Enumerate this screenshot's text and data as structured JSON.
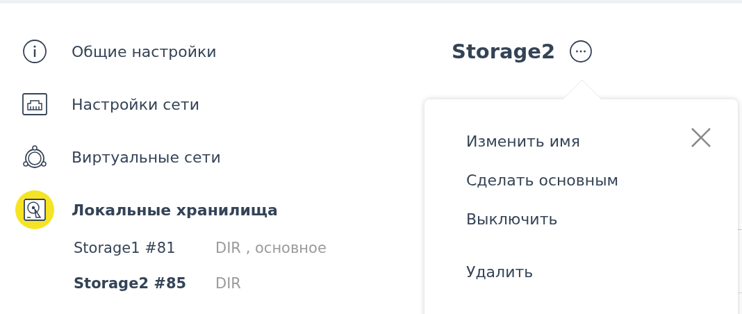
{
  "sidebar": {
    "items": [
      {
        "label": "Общие настройки",
        "kind": "info",
        "selected": false
      },
      {
        "label": "Настройки сети",
        "kind": "network",
        "selected": false
      },
      {
        "label": "Виртуальные сети",
        "kind": "virtual",
        "selected": false
      },
      {
        "label": "Локальные хранилища",
        "kind": "storage",
        "selected": true
      }
    ],
    "storages": [
      {
        "name": "Storage1 #81",
        "type": "DIR , основное",
        "selected": false
      },
      {
        "name": "Storage2 #85",
        "type": "DIR",
        "selected": true
      }
    ]
  },
  "title": "Storage2",
  "menu": {
    "items": [
      "Изменить имя",
      "Сделать основным",
      "Выключить",
      "Удалить"
    ]
  }
}
